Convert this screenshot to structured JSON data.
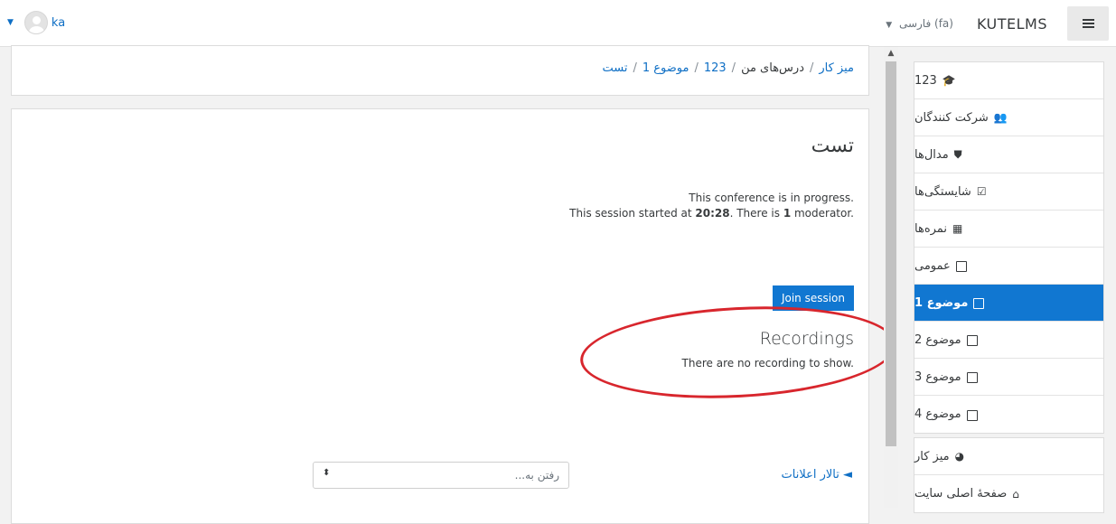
{
  "header": {
    "username": "ka",
    "language": "فارسی (fa)",
    "brand": "KUTELMS"
  },
  "breadcrumb": {
    "items": [
      "میز کار",
      "درس‌های من",
      "123",
      "موضوع 1",
      "تست"
    ],
    "separator": "/"
  },
  "main": {
    "title": "تست",
    "status_line1": "This conference is in progress.",
    "status_line2_prefix": "This session started at ",
    "status_time": "20:28",
    "status_line2_mid": ". There is ",
    "status_count": "1",
    "status_line2_suffix": " moderator.",
    "join_button": "Join session",
    "recordings_title": "Recordings",
    "recordings_empty": "There are no recording to show.",
    "forum_link": "◄ تالار اعلانات",
    "goto_placeholder": "رفتن به...",
    "goto_arrows": "⬍"
  },
  "sidebar": {
    "group1": [
      {
        "label": "123",
        "icon": "graduation-cap-icon",
        "glyph": "🎓"
      },
      {
        "label": "شرکت کنندگان",
        "icon": "users-icon",
        "glyph": "👥"
      },
      {
        "label": "مدال‌ها",
        "icon": "shield-icon",
        "glyph": "⛊"
      },
      {
        "label": "شایستگی‌ها",
        "icon": "check-square-icon",
        "glyph": "☑"
      },
      {
        "label": "نمره‌ها",
        "icon": "table-icon",
        "glyph": "▦"
      },
      {
        "label": "عمومی",
        "icon": "folder-icon"
      },
      {
        "label": "موضوع 1",
        "icon": "folder-icon",
        "active": true
      },
      {
        "label": "موضوع 2",
        "icon": "folder-icon"
      },
      {
        "label": "موضوع 3",
        "icon": "folder-icon"
      },
      {
        "label": "موضوع 4",
        "icon": "folder-icon"
      }
    ],
    "group2": [
      {
        "label": "میز کار",
        "icon": "dashboard-icon",
        "glyph": "◕"
      },
      {
        "label": "صفحهٔ اصلی سایت",
        "icon": "home-icon",
        "glyph": "⌂"
      }
    ]
  },
  "colors": {
    "accent": "#1177d1",
    "link": "#0f6fc5",
    "annotation": "#d8262d"
  }
}
